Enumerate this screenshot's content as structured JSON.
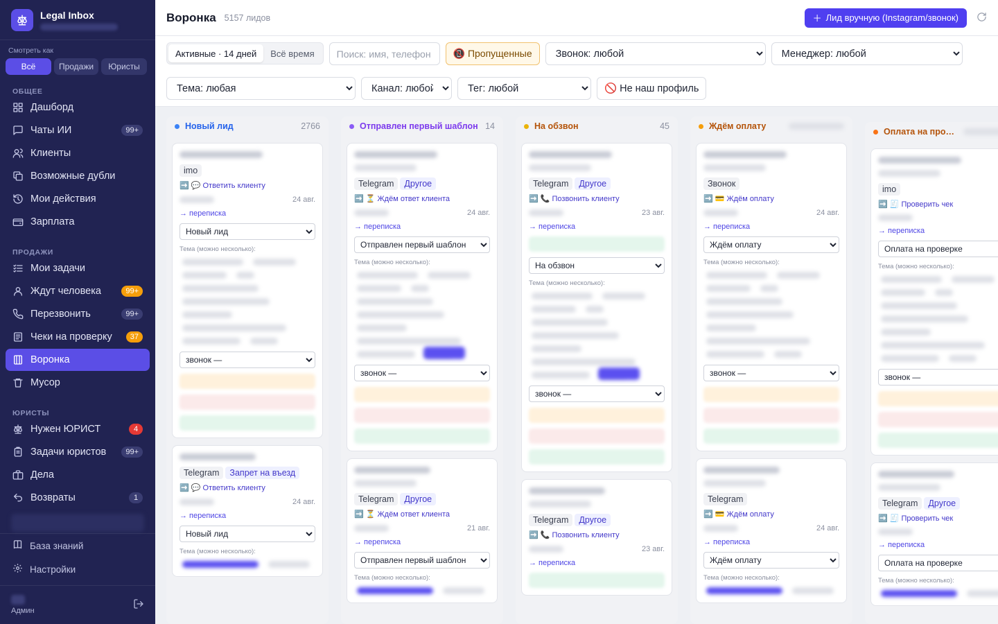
{
  "app": {
    "title": "Legal Inbox"
  },
  "view_as": {
    "label": "Смотреть как",
    "options": [
      "Всё",
      "Продажи",
      "Юристы"
    ],
    "active": 0
  },
  "sidebar": {
    "sections": [
      {
        "title": "ОБЩЕЕ",
        "items": [
          {
            "label": "Дашборд",
            "icon": "dashboard-icon",
            "badge": ""
          },
          {
            "label": "Чаты ИИ",
            "icon": "chat-icon",
            "badge": "99+"
          },
          {
            "label": "Клиенты",
            "icon": "users-icon",
            "badge": ""
          },
          {
            "label": "Возможные дубли",
            "icon": "duplicate-icon",
            "badge": ""
          },
          {
            "label": "Мои действия",
            "icon": "history-icon",
            "badge": ""
          },
          {
            "label": "Зарплата",
            "icon": "wallet-icon",
            "badge": ""
          }
        ]
      },
      {
        "title": "ПРОДАЖИ",
        "items": [
          {
            "label": "Мои задачи",
            "icon": "tasks-icon",
            "badge": ""
          },
          {
            "label": "Ждут человека",
            "icon": "person-icon",
            "badge": "99+",
            "badge_color": "orange"
          },
          {
            "label": "Перезвонить",
            "icon": "phone-icon",
            "badge": "99+"
          },
          {
            "label": "Чеки на проверку",
            "icon": "receipt-icon",
            "badge": "37",
            "badge_color": "orange"
          },
          {
            "label": "Воронка",
            "icon": "funnel-icon",
            "badge": "",
            "active": true
          },
          {
            "label": "Мусор",
            "icon": "trash-icon",
            "badge": ""
          }
        ]
      },
      {
        "title": "ЮРИСТЫ",
        "items": [
          {
            "label": "Нужен ЮРИСТ",
            "icon": "scales-icon",
            "badge": "4",
            "badge_color": "red"
          },
          {
            "label": "Задачи юристов",
            "icon": "clipboard-icon",
            "badge": "99+"
          },
          {
            "label": "Дела",
            "icon": "briefcase-icon",
            "badge": ""
          },
          {
            "label": "Возвраты",
            "icon": "return-icon",
            "badge": "1"
          }
        ]
      }
    ],
    "footer": {
      "knowledge": "База знаний",
      "settings": "Настройки",
      "role": "Админ"
    }
  },
  "header": {
    "title": "Воронка",
    "count": "5157 лидов",
    "add_button": "Лид вручную (Instagram/звонок)"
  },
  "filters": {
    "period": [
      "Активные · 14 дней",
      "Всё время"
    ],
    "search_placeholder": "Поиск: имя, телефон",
    "missed": "Пропущенные",
    "call": "Звонок: любой",
    "manager": "Менеджер: любой",
    "topic": "Тема: любая",
    "channel": "Канал: любой",
    "tag": "Тег: любой",
    "not_our": "Не наш профиль"
  },
  "colors": {
    "accent": "#5b4ee6",
    "sidebar": "#212352"
  },
  "columns": [
    {
      "name": "Новый лид",
      "count": "2766",
      "color": "#3b82f6",
      "cards": [
        {
          "channel": "imo",
          "topic": "",
          "action": "➡️ 💬 Ответить клиенту",
          "date": "24 авг.",
          "chat": "→ переписка",
          "stage": "Новый лид",
          "call": "звонок —"
        },
        {
          "channel": "Telegram",
          "topic": "Запрет на въезд",
          "action": "➡️ 💬 Ответить клиенту",
          "date": "24 авг.",
          "chat": "→ переписка",
          "stage": "Новый лид",
          "call": ""
        }
      ]
    },
    {
      "name": "Отправлен первый шаблон",
      "count": "14",
      "color": "#8b5cf6",
      "cards": [
        {
          "channel": "Telegram",
          "topic": "Другое",
          "action": "➡️ ⏳ Ждём ответ клиента",
          "date": "24 авг.",
          "chat": "→ переписка",
          "stage": "Отправлен первый шаблон",
          "call": "звонок —"
        },
        {
          "channel": "Telegram",
          "topic": "Другое",
          "action": "➡️ ⏳ Ждём ответ клиента",
          "date": "21 авг.",
          "chat": "→ переписка",
          "stage": "Отправлен первый шаблон",
          "call": ""
        }
      ]
    },
    {
      "name": "На обзвон",
      "count": "45",
      "color": "#eab308",
      "cards": [
        {
          "channel": "Telegram",
          "topic": "Другое",
          "action": "➡️ 📞 Позвонить клиенту",
          "date": "23 авг.",
          "chat": "→ переписка",
          "stage": "На обзвон",
          "call": "звонок —"
        },
        {
          "channel": "Telegram",
          "topic": "Другое",
          "action": "➡️ 📞 Позвонить клиенту",
          "date": "23 авг.",
          "chat": "→ переписка",
          "stage": "",
          "call": ""
        }
      ]
    },
    {
      "name": "Ждём оплату",
      "count": "",
      "color": "#f59e0b",
      "cards": [
        {
          "channel": "Звонок",
          "topic": "",
          "action": "➡️ 💳 Ждём оплату",
          "date": "24 авг.",
          "chat": "→ переписка",
          "stage": "Ждём оплату",
          "call": "звонок —"
        },
        {
          "channel": "Telegram",
          "topic": "",
          "action": "➡️ 💳 Ждём оплату",
          "date": "24 авг.",
          "chat": "→ переписка",
          "stage": "Ждём оплату",
          "call": ""
        }
      ]
    },
    {
      "name": "Оплата на проверке",
      "count": "",
      "color": "#f97316",
      "cards": [
        {
          "channel": "imo",
          "topic": "",
          "action": "➡️ 🧾 Проверить чек",
          "date": "",
          "chat": "→ переписка",
          "stage": "Оплата на проверке",
          "call": "звонок —"
        },
        {
          "channel": "Telegram",
          "topic": "Другое",
          "action": "➡️ 🧾 Проверить чек",
          "date": "",
          "chat": "→ переписка",
          "stage": "Оплата на проверке",
          "call": ""
        }
      ]
    }
  ],
  "card_labels": {
    "topic_hint": "Тема (можно несколько):"
  }
}
